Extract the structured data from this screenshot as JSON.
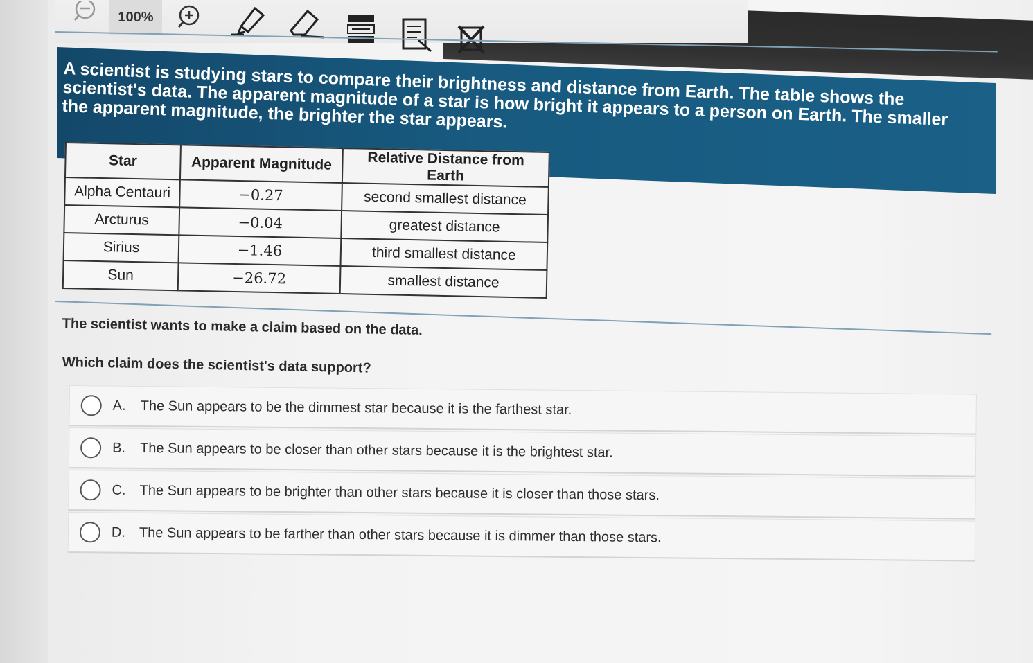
{
  "toolbar": {
    "zoom_out_icon": "zoom-out-icon",
    "zoom_level": "100%",
    "zoom_in_icon": "zoom-in-icon",
    "highlighter_icon": "highlighter-icon",
    "eraser_icon": "eraser-icon",
    "line_reader_icon": "line-reader-icon",
    "notepad_icon": "notepad-icon",
    "answer_eliminator_icon": "answer-eliminator-icon"
  },
  "passage": {
    "text": "A scientist is studying stars to compare their brightness and distance from Earth. The table shows the scientist's data. The apparent magnitude of a star is how bright it appears to a person on Earth. The smaller the apparent magnitude, the brighter the star appears."
  },
  "table": {
    "headers": [
      "Star",
      "Apparent Magnitude",
      "Relative Distance from Earth"
    ],
    "rows": [
      [
        "Alpha Centauri",
        "−0.27",
        "second smallest distance"
      ],
      [
        "Arcturus",
        "−0.04",
        "greatest distance"
      ],
      [
        "Sirius",
        "−1.46",
        "third smallest distance"
      ],
      [
        "Sun",
        "−26.72",
        "smallest distance"
      ]
    ]
  },
  "question": {
    "context": "The scientist wants to make a claim based on the data.",
    "prompt": "Which claim does the scientist's data support?",
    "options": [
      {
        "letter": "A.",
        "text": "The Sun appears to be the dimmest star because it is the farthest star."
      },
      {
        "letter": "B.",
        "text": "The Sun appears to be closer than other stars because it is the brightest star."
      },
      {
        "letter": "C.",
        "text": "The Sun appears to be brighter than other stars because it is closer than those stars."
      },
      {
        "letter": "D.",
        "text": "The Sun appears to be farther than other stars because it is dimmer than those stars."
      }
    ]
  },
  "colors": {
    "header_band": "#185a80",
    "separator": "#7fa2b7"
  }
}
